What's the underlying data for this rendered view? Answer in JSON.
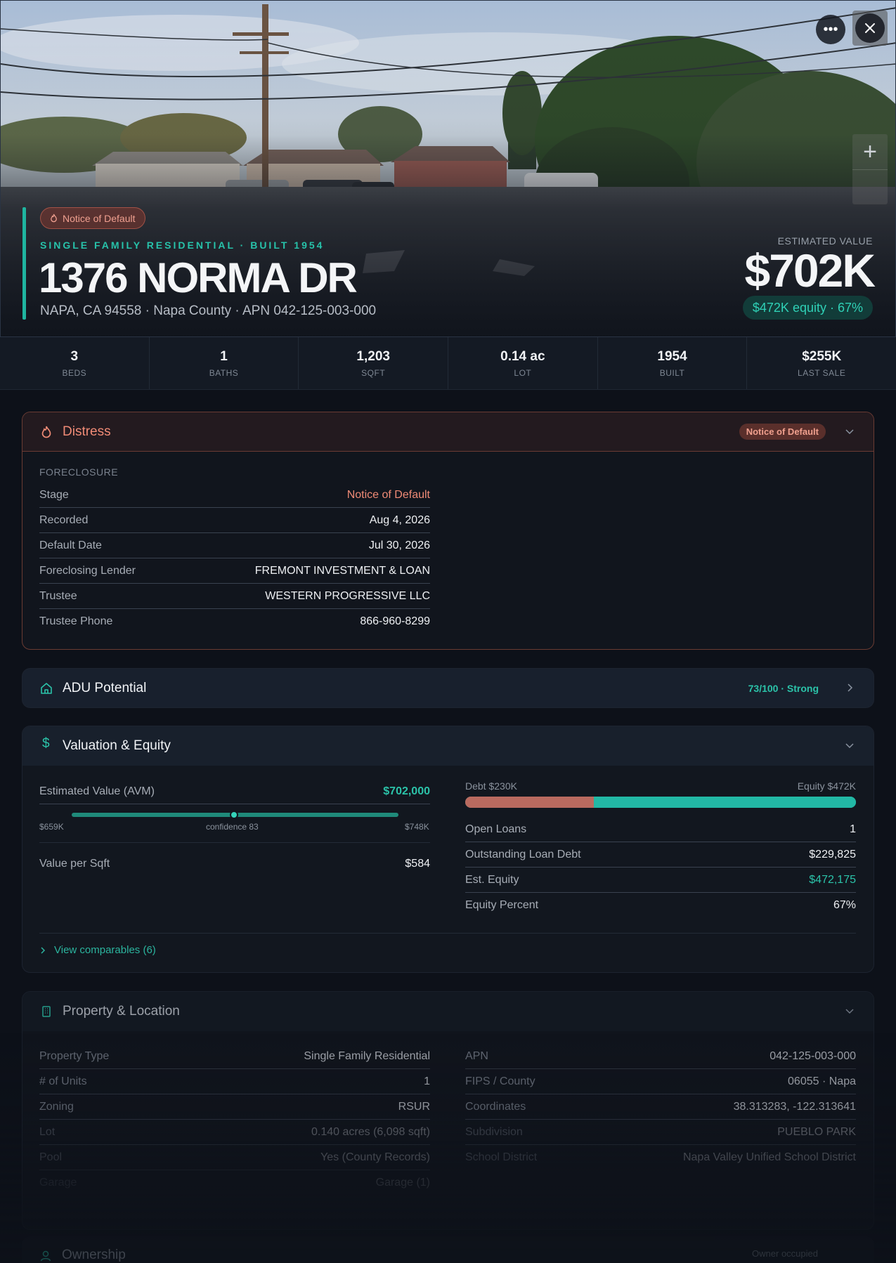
{
  "hero": {
    "status_pill": "Notice of Default",
    "subtitle": "SINGLE FAMILY RESIDENTIAL · BUILT 1954",
    "address": "1376 NORMA DR",
    "location": "NAPA, CA 94558 · Napa County · APN 042-125-003-000",
    "estimated_value_label": "ESTIMATED VALUE",
    "estimated_value": "$702K",
    "equity_pill": "$472K equity · 67%"
  },
  "stats": [
    {
      "value": "3",
      "label": "BEDS"
    },
    {
      "value": "1",
      "label": "BATHS"
    },
    {
      "value": "1,203",
      "label": "SQFT"
    },
    {
      "value": "0.14 ac",
      "label": "LOT"
    },
    {
      "value": "1954",
      "label": "BUILT"
    },
    {
      "value": "$255K",
      "label": "LAST SALE"
    }
  ],
  "distress": {
    "title": "Distress",
    "badge": "Notice of Default",
    "subhead": "FORECLOSURE",
    "rows": [
      {
        "k": "Stage",
        "v": "Notice of Default"
      },
      {
        "k": "Recorded",
        "v": "Aug 4, 2026"
      },
      {
        "k": "Default Date",
        "v": "Jul 30, 2026"
      },
      {
        "k": "Foreclosing Lender",
        "v": "FREMONT INVESTMENT & LOAN"
      },
      {
        "k": "Trustee",
        "v": "WESTERN PROGRESSIVE LLC"
      },
      {
        "k": "Trustee Phone",
        "v": "866-960-8299"
      }
    ],
    "accent_color": "#f08b76"
  },
  "adu": {
    "title": "ADU Potential",
    "score": "73/100 · Strong"
  },
  "valuation": {
    "title": "Valuation & Equity",
    "avm_label": "Estimated Value (AVM)",
    "avm_value": "$702,000",
    "range_low": "$659K",
    "range_high": "$748K",
    "confidence": "confidence 83",
    "vps_label": "Value per Sqft",
    "vps_value": "$584",
    "debt_label": "Debt $230K",
    "equity_label": "Equity $472K",
    "debt_fraction": 0.33,
    "rows": [
      {
        "k": "Open Loans",
        "v": "1"
      },
      {
        "k": "Outstanding Loan Debt",
        "v": "$229,825"
      },
      {
        "k": "Est. Equity",
        "v": "$472,175"
      },
      {
        "k": "Equity Percent",
        "v": "67%"
      }
    ],
    "comparables": "View comparables (6)"
  },
  "property": {
    "title": "Property & Location",
    "left": [
      {
        "k": "Property Type",
        "v": "Single Family Residential"
      },
      {
        "k": "# of Units",
        "v": "1"
      },
      {
        "k": "Zoning",
        "v": "RSUR"
      },
      {
        "k": "Lot",
        "v": "0.140 acres (6,098 sqft)"
      },
      {
        "k": "Pool",
        "v": "Yes (County Records)"
      },
      {
        "k": "Garage",
        "v": "Garage (1)"
      }
    ],
    "right": [
      {
        "k": "APN",
        "v": "042-125-003-000"
      },
      {
        "k": "FIPS / County",
        "v": "06055 · Napa"
      },
      {
        "k": "Coordinates",
        "v": "38.313283, -122.313641"
      },
      {
        "k": "Subdivision",
        "v": "PUEBLO PARK"
      },
      {
        "k": "School District",
        "v": "Napa Valley Unified School District"
      }
    ]
  },
  "ownership": {
    "title": "Ownership",
    "badge": "Owner occupied"
  },
  "colors": {
    "accent": "#1fb5a0",
    "distress": "#f08b76",
    "debt": "#b96a5f"
  }
}
